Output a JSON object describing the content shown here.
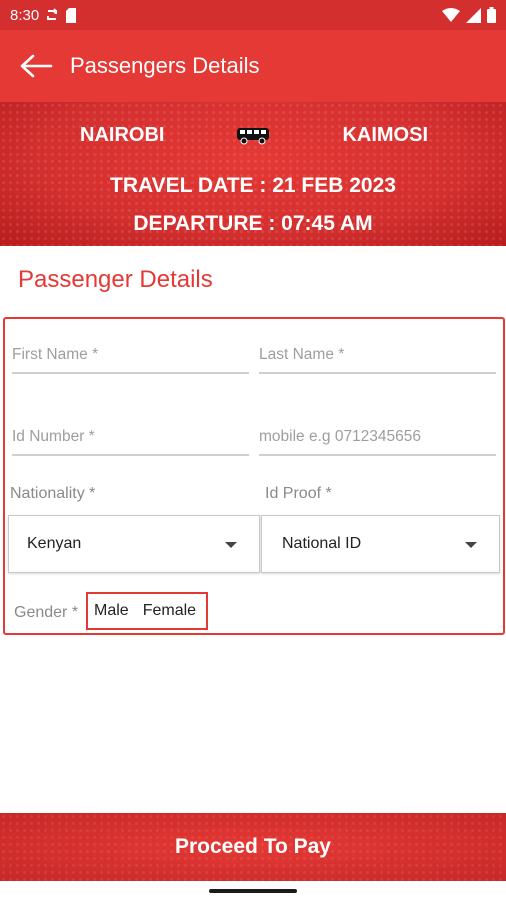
{
  "status_bar": {
    "time": "8:30"
  },
  "app_bar": {
    "title": "Passengers Details"
  },
  "route": {
    "from": "NAIROBI",
    "to": "KAIMOSI",
    "travel_date": "TRAVEL DATE : 21 FEB 2023",
    "departure": "DEPARTURE : 07:45 AM"
  },
  "section": {
    "title": "Passenger Details"
  },
  "form": {
    "first_name_placeholder": "First Name *",
    "last_name_placeholder": "Last Name *",
    "id_number_placeholder": "Id Number *",
    "mobile_placeholder": "mobile e.g 0712345656",
    "nationality_label": "Nationality *",
    "nationality_value": "Kenyan",
    "id_proof_label": "Id Proof *",
    "id_proof_value": "National ID",
    "gender_label": "Gender *",
    "gender_options": [
      "Male",
      "Female"
    ]
  },
  "button": {
    "proceed_label": "Proceed To Pay"
  },
  "colors": {
    "brand": "#e53935",
    "brand_dark": "#d32f2f"
  },
  "icons": [
    "back-arrow-icon",
    "bus-icon",
    "wifi-icon",
    "signal-icon",
    "battery-icon",
    "sync-icon",
    "sd-card-icon"
  ]
}
